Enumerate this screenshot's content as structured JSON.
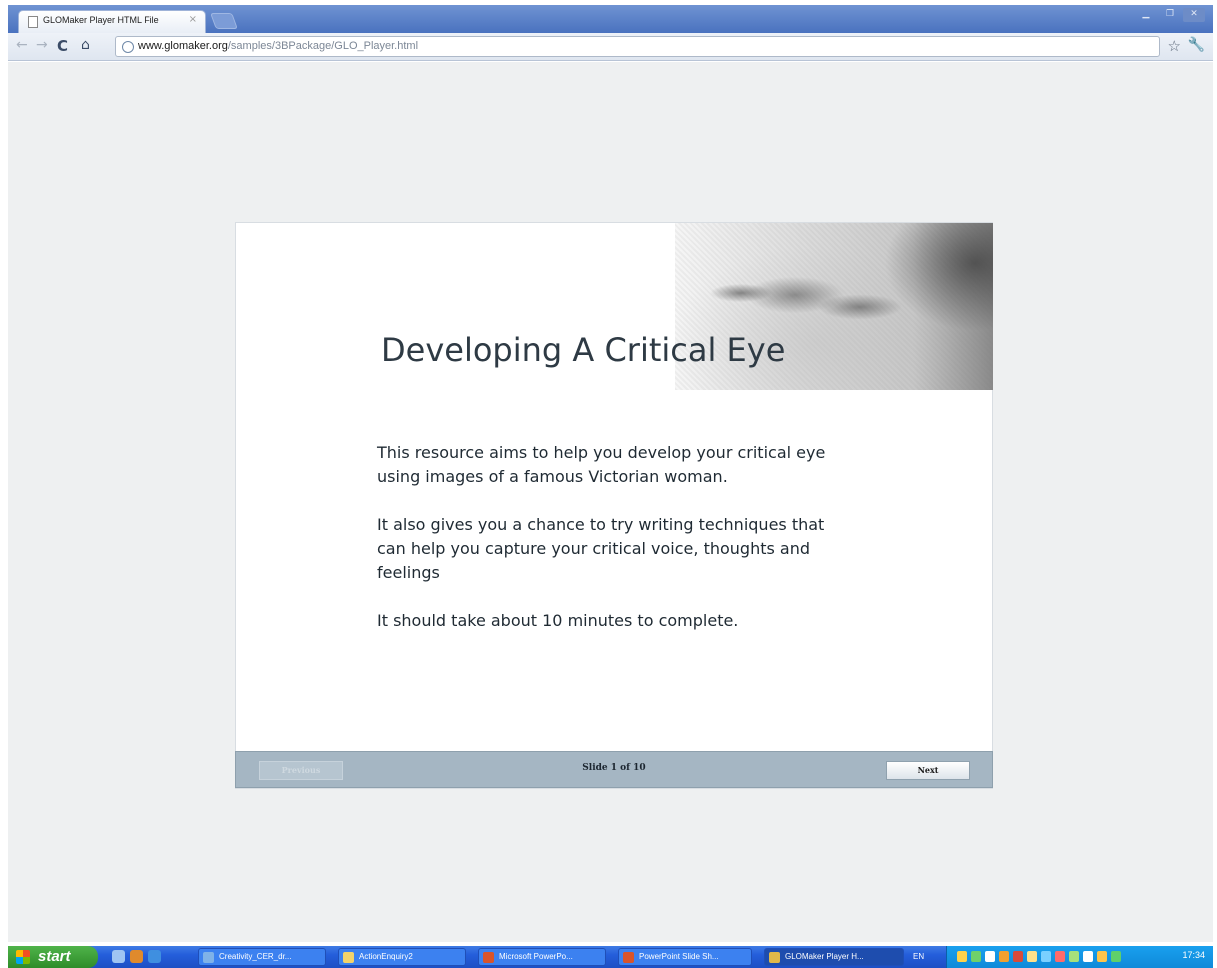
{
  "browser": {
    "tab_title": "GLOMaker Player HTML File",
    "tab_close": "×",
    "url_host": "www.glomaker.org",
    "url_path": "/samples/3BPackage/GLO_Player.html"
  },
  "slide": {
    "title": "Developing A Critical Eye",
    "paragraphs": [
      "This resource aims to help you develop your critical eye using images of a famous Victorian woman.",
      "It also gives you a chance to try writing techniques that can help you capture your critical voice, thoughts and feelings",
      "It should take about 10 minutes to complete."
    ],
    "previous_label": "Previous",
    "previous_enabled": false,
    "next_label": "Next",
    "counter_text": "Slide 1 of 10",
    "current_slide": 1,
    "total_slides": 10
  },
  "taskbar": {
    "start_label": "start",
    "buttons": [
      {
        "label": "Creativity_CER_dr...",
        "icon_color": "#7fb2e8"
      },
      {
        "label": "ActionEnquiry2",
        "icon_color": "#f3d36b"
      },
      {
        "label": "Microsoft PowerPo...",
        "icon_color": "#d9542b"
      },
      {
        "label": "PowerPoint Slide Sh...",
        "icon_color": "#d9542b"
      },
      {
        "label": "GLOMaker Player H...",
        "icon_color": "#e0b84a"
      }
    ],
    "language": "EN",
    "clock": "17:34"
  },
  "colors": {
    "page_background": "#eef0f1",
    "control_bar": "#a5b6c3",
    "title_text": "#2e3a44",
    "taskbar_blue": "#245edb",
    "start_green": "#3a9d35"
  }
}
